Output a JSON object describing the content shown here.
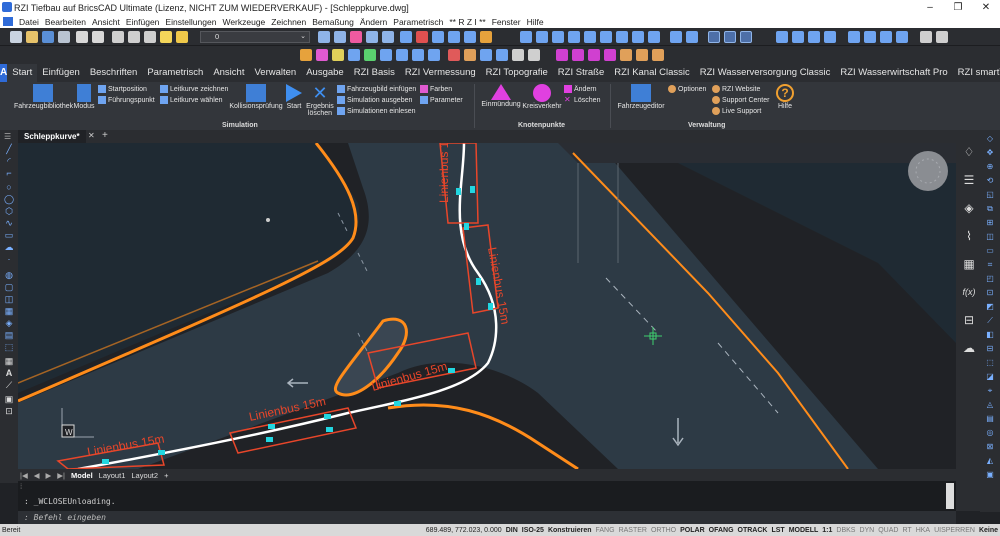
{
  "window": {
    "title": "RZI Tiefbau auf BricsCAD Ultimate (Lizenz, NICHT ZUM WIEDERVERKAUF) - [Schleppkurve.dwg]",
    "minimize": "–",
    "maximize": "❐",
    "close": "✕"
  },
  "menu": [
    "Datei",
    "Bearbeiten",
    "Ansicht",
    "Einfügen",
    "Einstellungen",
    "Werkzeuge",
    "Zeichnen",
    "Bemaßung",
    "Ändern",
    "Parametrisch",
    "** R Z I **",
    "Fenster",
    "Hilfe"
  ],
  "toolbar": {
    "layer_value": "0"
  },
  "ribbon_tabs": [
    "Start",
    "Einfügen",
    "Beschriften",
    "Parametrisch",
    "Ansicht",
    "Verwalten",
    "Ausgabe",
    "RZI Basis",
    "RZI Vermessung",
    "RZI Topografie",
    "RZI Straße",
    "RZI Kanal Classic",
    "RZI Wasserversorgung Classic",
    "RZI Wasserwirtschaft Pro",
    "RZI smartTurn"
  ],
  "ribbon": {
    "simulation": {
      "label": "Simulation",
      "fahrzeugbibliothek": "Fahrzeugbibliothek",
      "modus": "Modus",
      "startposition": "Startposition",
      "fuehrungspunkt": "Führungspunkt",
      "leitkurve_zeichnen": "Leitkurve zeichnen",
      "leitkurve_waehlen": "Leitkurve wählen",
      "kollisionspruefung": "Kollisionsprüfung",
      "start": "Start",
      "ergebnis": "Ergebnis",
      "loeschen": "löschen",
      "fahrzeugbild": "Fahrzeugbild einfügen",
      "sim_ausgeben": "Simulation ausgeben",
      "sim_einlesen": "Simulationen einlesen",
      "farben": "Farben",
      "parameter": "Parameter"
    },
    "knotenpunkte": {
      "label": "Knotenpunkte",
      "einmuendung": "Einmündung",
      "kreisverkehr": "Kreisverkehr",
      "aendern": "Ändern",
      "loeschen": "Löschen"
    },
    "verwaltung": {
      "label": "Verwaltung",
      "fahrzeugeditor": "Fahrzeugeditor",
      "optionen": "Optionen",
      "website": "RZI Website",
      "support": "Support Center",
      "live": "Live Support",
      "hilfe": "Hilfe"
    }
  },
  "document_tab": {
    "name": "Schleppkurve*",
    "close": "✕",
    "add": "+"
  },
  "drawing": {
    "bus_labels": [
      "Linienbus 15m",
      "Linienbus 15m",
      "Linienbus 15m",
      "Linienbus 15m",
      "Linienbus 15m"
    ],
    "ucs_label": "W",
    "colors": {
      "road": "#2d3a45",
      "curb": "#ff8c1a",
      "vehicle": "#e8462a",
      "marker": "#22d6e0",
      "path": "#ffffff",
      "background": "#202226"
    }
  },
  "layout_tabs": [
    "Model",
    "Layout1",
    "Layout2"
  ],
  "layout_add": "+",
  "command": {
    "history": ": _WCLOSEUnloading.",
    "prompt": ": Befehl eingeben"
  },
  "status": {
    "ready": "Bereit",
    "coords": "689.489, 772.023, 0.000",
    "items": [
      "DIN",
      "ISO-25",
      "Konstruieren",
      "FANG",
      "RASTER",
      "ORTHO",
      "POLAR",
      "OFANG",
      "OTRACK",
      "LST",
      "MODELL",
      "1:1",
      "DBKS",
      "DYN",
      "QUAD",
      "RT",
      "HKA",
      "UISPERREN",
      "Keine"
    ],
    "active": [
      "DIN",
      "ISO-25",
      "Konstruieren",
      "POLAR",
      "OFANG",
      "OTRACK",
      "LST",
      "MODELL",
      "1:1",
      "Keine"
    ]
  }
}
